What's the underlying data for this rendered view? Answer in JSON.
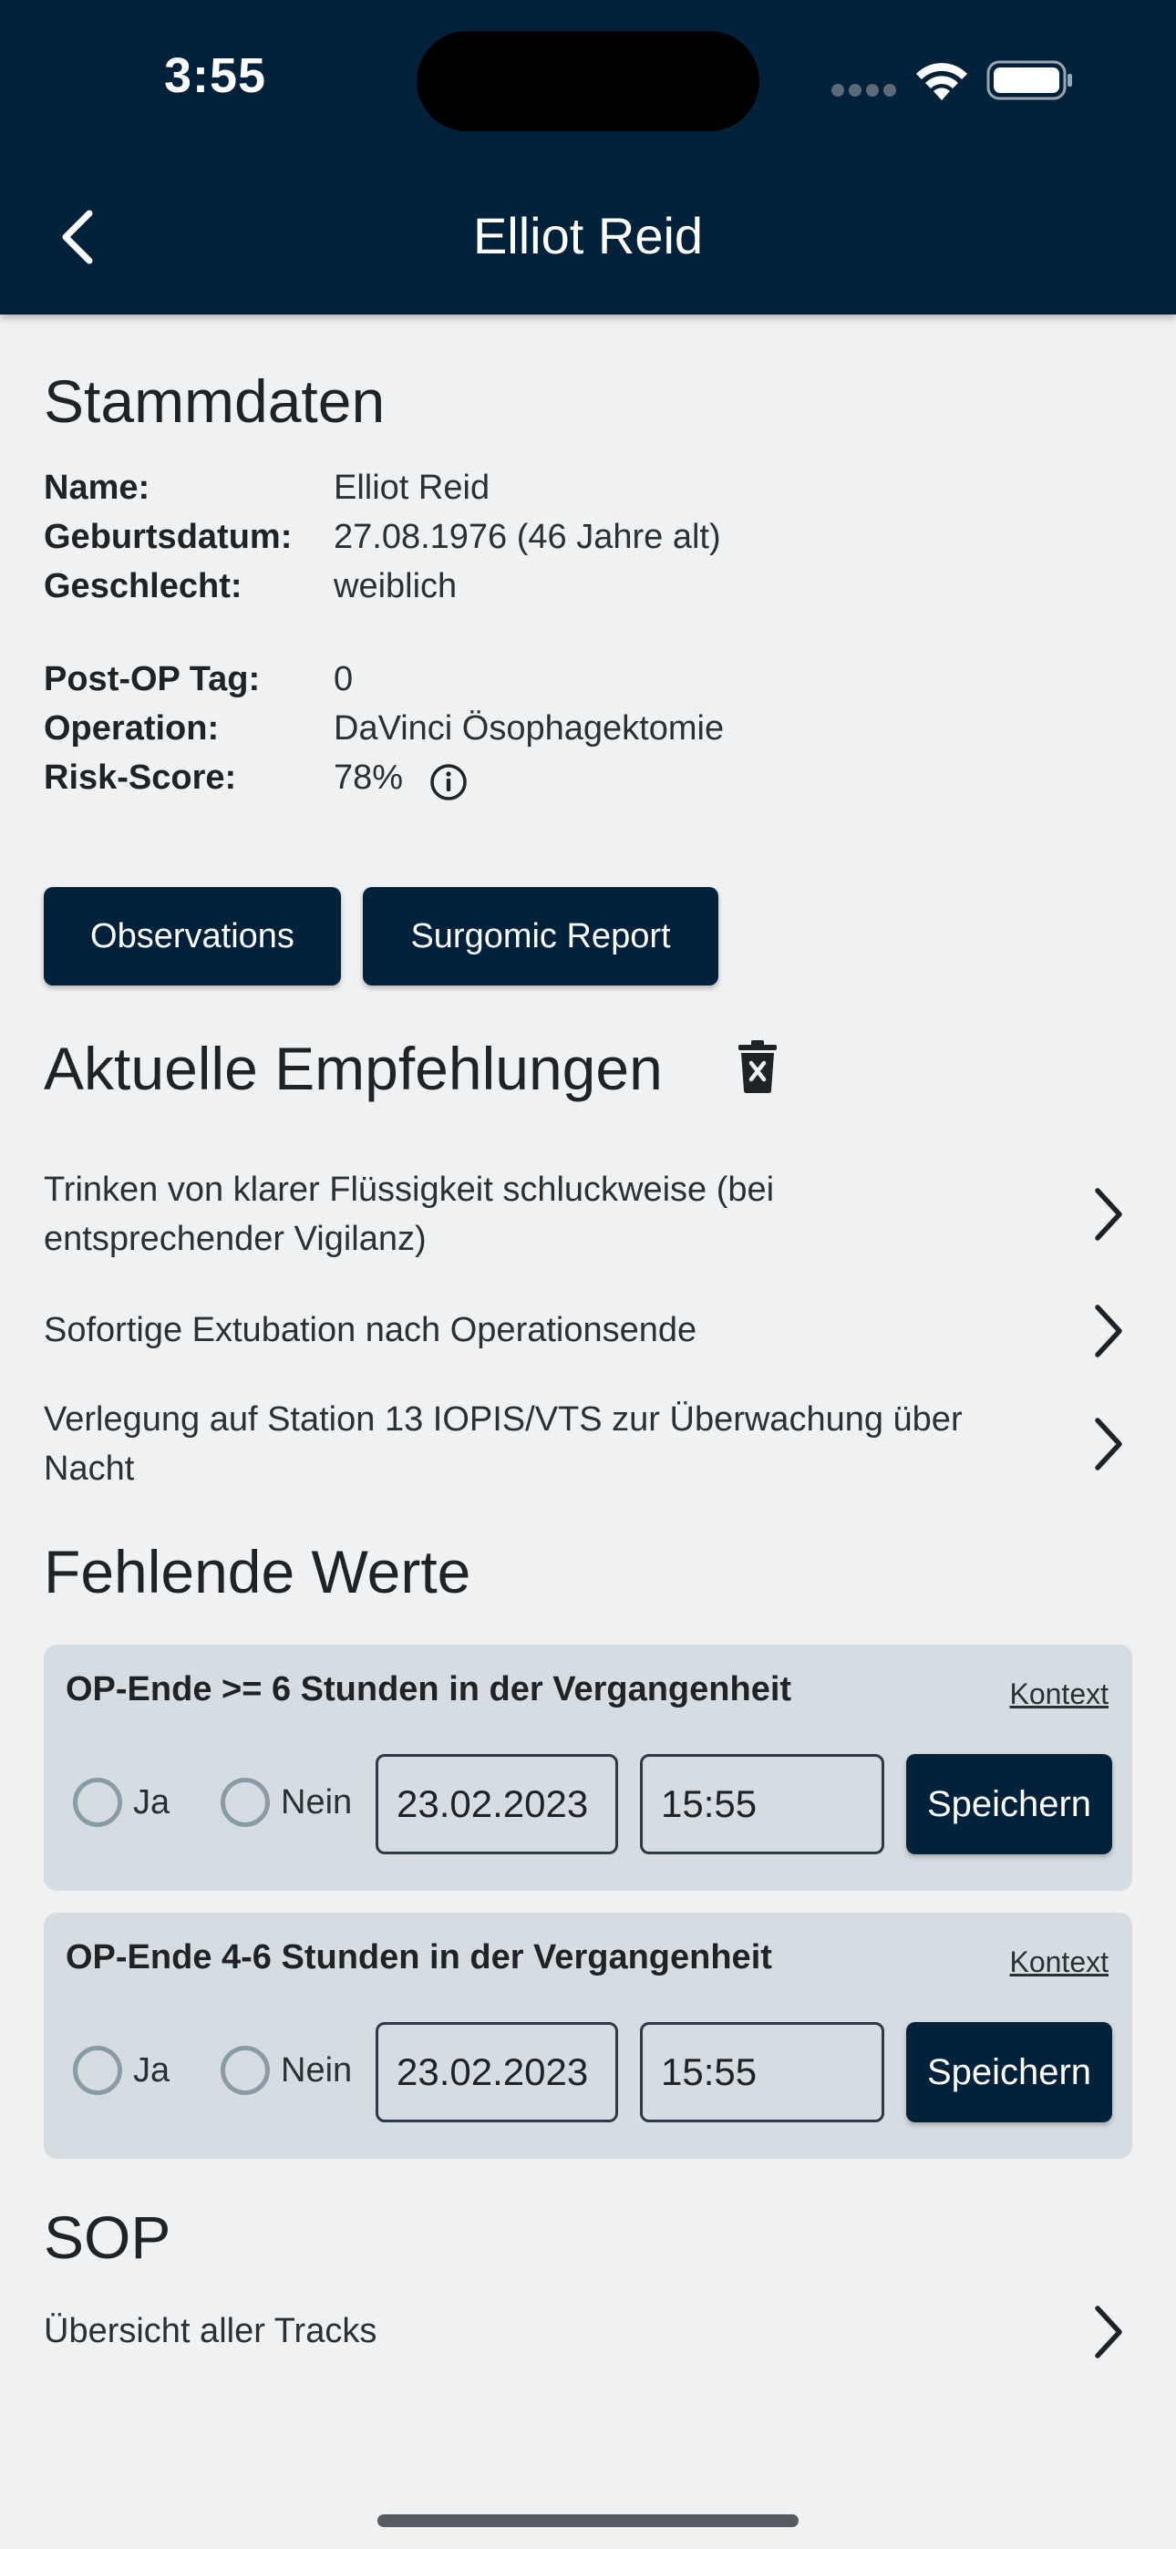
{
  "status_bar": {
    "time": "3:55"
  },
  "header": {
    "title": "Elliot Reid"
  },
  "stammdaten": {
    "heading": "Stammdaten",
    "fields": [
      {
        "label": "Name:",
        "value": "Elliot Reid"
      },
      {
        "label": "Geburtsdatum:",
        "value": "27.08.1976 (46 Jahre alt)"
      },
      {
        "label": "Geschlecht:",
        "value": "weiblich"
      },
      {
        "label": "Post-OP Tag:",
        "value": "0"
      },
      {
        "label": "Operation:",
        "value": "DaVinci Ösophagektomie"
      },
      {
        "label": "Risk-Score:",
        "value": "78%"
      }
    ]
  },
  "buttons": {
    "observations": "Observations",
    "surgomic_report": "Surgomic Report"
  },
  "empfehlungen": {
    "heading": "Aktuelle Empfehlungen",
    "items": [
      "Trinken von klarer Flüssigkeit schluckweise (bei entsprechender Vigilanz)",
      "Sofortige Extubation nach Operationsende",
      "Verlegung auf Station 13 IOPIS/VTS zur Überwachung über Nacht"
    ]
  },
  "fehlende_werte": {
    "heading": "Fehlende Werte",
    "cards": [
      {
        "title": "OP-Ende >= 6 Stunden in der Vergangenheit",
        "link": "Kontext",
        "yes": "Ja",
        "no": "Nein",
        "date": "23.02.2023",
        "time": "15:55",
        "save": "Speichern"
      },
      {
        "title": "OP-Ende 4-6 Stunden in der Vergangenheit",
        "link": "Kontext",
        "yes": "Ja",
        "no": "Nein",
        "date": "23.02.2023",
        "time": "15:55",
        "save": "Speichern"
      }
    ]
  },
  "sop": {
    "heading": "SOP",
    "item": "Übersicht aller Tracks"
  },
  "icons": {
    "back": "chevron-left-icon",
    "info": "info-icon",
    "trash": "trash-icon",
    "chevron": "chevron-right-icon"
  },
  "colors": {
    "primary": "#02223b",
    "background": "#eff1f3",
    "card": "#d6dde2"
  }
}
